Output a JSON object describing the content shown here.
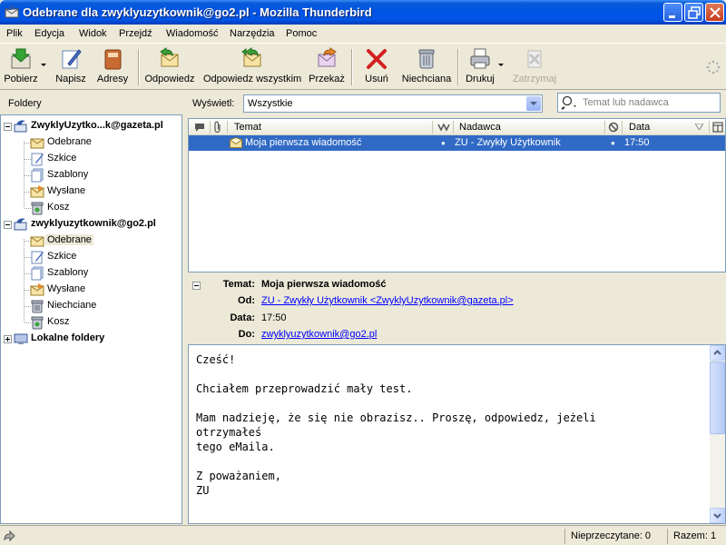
{
  "window": {
    "title": "Odebrane dla zwyklyuzytkownik@go2.pl - Mozilla Thunderbird"
  },
  "menu": [
    "Plik",
    "Edycja",
    "Widok",
    "Przejdź",
    "Wiadomość",
    "Narzędzia",
    "Pomoc"
  ],
  "toolbar": {
    "get": "Pobierz",
    "write": "Napisz",
    "address": "Adresy",
    "reply": "Odpowiedz",
    "reply_all": "Odpowiedz wszystkim",
    "forward": "Przekaż",
    "delete": "Usuń",
    "junk": "Niechciana",
    "print": "Drukuj",
    "stop": "Zatrzymaj"
  },
  "folders": {
    "header": "Foldery",
    "accounts": [
      {
        "name": "ZwyklyUzytko...k@gazeta.pl",
        "items": [
          "Odebrane",
          "Szkice",
          "Szablony",
          "Wysłane",
          "Kosz"
        ]
      },
      {
        "name": "zwyklyuzytkownik@go2.pl",
        "items": [
          "Odebrane",
          "Szkice",
          "Szablony",
          "Wysłane",
          "Niechciane",
          "Kosz"
        ]
      },
      {
        "name": "Lokalne foldery",
        "items": []
      }
    ]
  },
  "view": {
    "label": "Wyświetl:",
    "selected": "Wszystkie"
  },
  "search": {
    "placeholder": "Temat lub nadawca"
  },
  "message_list": {
    "columns": {
      "subject": "Temat",
      "sender": "Nadawca",
      "date": "Data"
    },
    "rows": [
      {
        "subject": "Moja pierwsza wiadomość",
        "sender": "ZU - Zwykły Użytkownik",
        "date": "17:50"
      }
    ]
  },
  "message": {
    "labels": {
      "subject": "Temat:",
      "from": "Od:",
      "date": "Data:",
      "to": "Do:"
    },
    "subject": "Moja pierwsza wiadomość",
    "from": "ZU - Zwykły Użytkownik <ZwyklyUzytkownik@gazeta.pl>",
    "date": "17:50",
    "to": "zwyklyuzytkownik@go2.pl",
    "body": [
      "Cześć!",
      "Chciałem przeprowadzić mały test.",
      "Mam nadzieję, że się nie obrazisz.. Proszę, odpowiedz, jeżeli\notrzymałeś\ntego eMaila.",
      "Z poważaniem,\nZU"
    ]
  },
  "status": {
    "unread": "Nieprzeczytane: 0",
    "total": "Razem: 1"
  }
}
